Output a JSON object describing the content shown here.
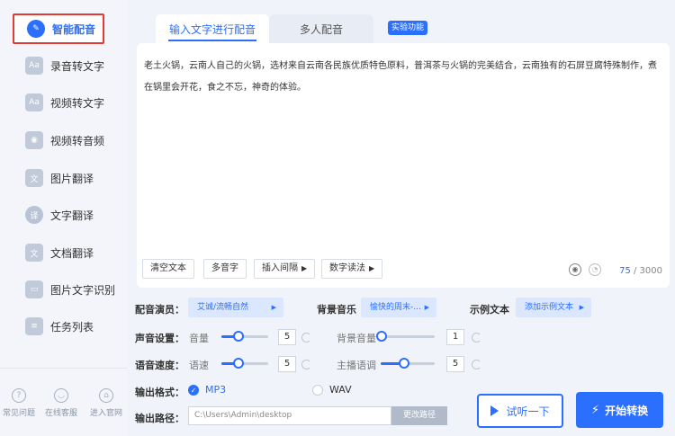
{
  "sidebar": {
    "items": [
      {
        "label": "智能配音",
        "icon": "mic-icon",
        "glyph": "✎"
      },
      {
        "label": "录音转文字",
        "icon": "audio-to-text-icon",
        "glyph": "Aa"
      },
      {
        "label": "视频转文字",
        "icon": "video-to-text-icon",
        "glyph": "Aa"
      },
      {
        "label": "视频转音频",
        "icon": "video-to-audio-icon",
        "glyph": "◉"
      },
      {
        "label": "图片翻译",
        "icon": "image-translate-icon",
        "glyph": "文"
      },
      {
        "label": "文字翻译",
        "icon": "text-translate-icon",
        "glyph": "译"
      },
      {
        "label": "文档翻译",
        "icon": "doc-translate-icon",
        "glyph": "文"
      },
      {
        "label": "图片文字识别",
        "icon": "ocr-icon",
        "glyph": "▭"
      },
      {
        "label": "任务列表",
        "icon": "task-list-icon",
        "glyph": "≡"
      }
    ],
    "bottom": [
      {
        "label": "常见问题",
        "icon": "question-icon",
        "glyph": "?"
      },
      {
        "label": "在线客服",
        "icon": "headset-icon",
        "glyph": "◡"
      },
      {
        "label": "进入官网",
        "icon": "website-icon",
        "glyph": "⌂"
      }
    ]
  },
  "tabs": {
    "tab1": "输入文字进行配音",
    "tab2": "多人配音",
    "badge": "实验功能"
  },
  "editor": {
    "text": "老土火锅，云南人自己的火锅，选材来自云南各民族优质特色原料，普洱茶与火锅的完美结合，云南独有的石屏豆腐特殊制作，煮在锅里会开花，食之不忘，神奇的体验。",
    "buttons": {
      "clear": "清空文本",
      "polyphone": "多音字",
      "insert_pause": "插入间隔",
      "number_read": "数字读法"
    },
    "count_current": "75",
    "count_max": " / 3000"
  },
  "settings": {
    "voice_label": "配音演员：",
    "voice_value": "艾诚/流畅自然",
    "bgm_label": "背景音乐",
    "bgm_value": "愉快的周末-...",
    "sample_label": "示例文本",
    "sample_value": "添加示例文本",
    "sound_label": "声音设置：",
    "volume_label": "音量",
    "volume_value": "5",
    "bg_volume_label": "背景音量",
    "bg_volume_value": "1",
    "speed_label": "语音速度：",
    "rate_label": "语速",
    "rate_value": "5",
    "pitch_label": "主播语调",
    "pitch_value": "5",
    "format_label": "输出格式：",
    "format_mp3": "MP3",
    "format_wav": "WAV",
    "path_label": "输出路径：",
    "path_value": "C:\\Users\\Admin\\desktop",
    "path_button": "更改路径"
  },
  "actions": {
    "preview": "试听一下",
    "start": "开始转换"
  },
  "colors": {
    "accent": "#2b6fff",
    "highlight_border": "#e53935"
  }
}
